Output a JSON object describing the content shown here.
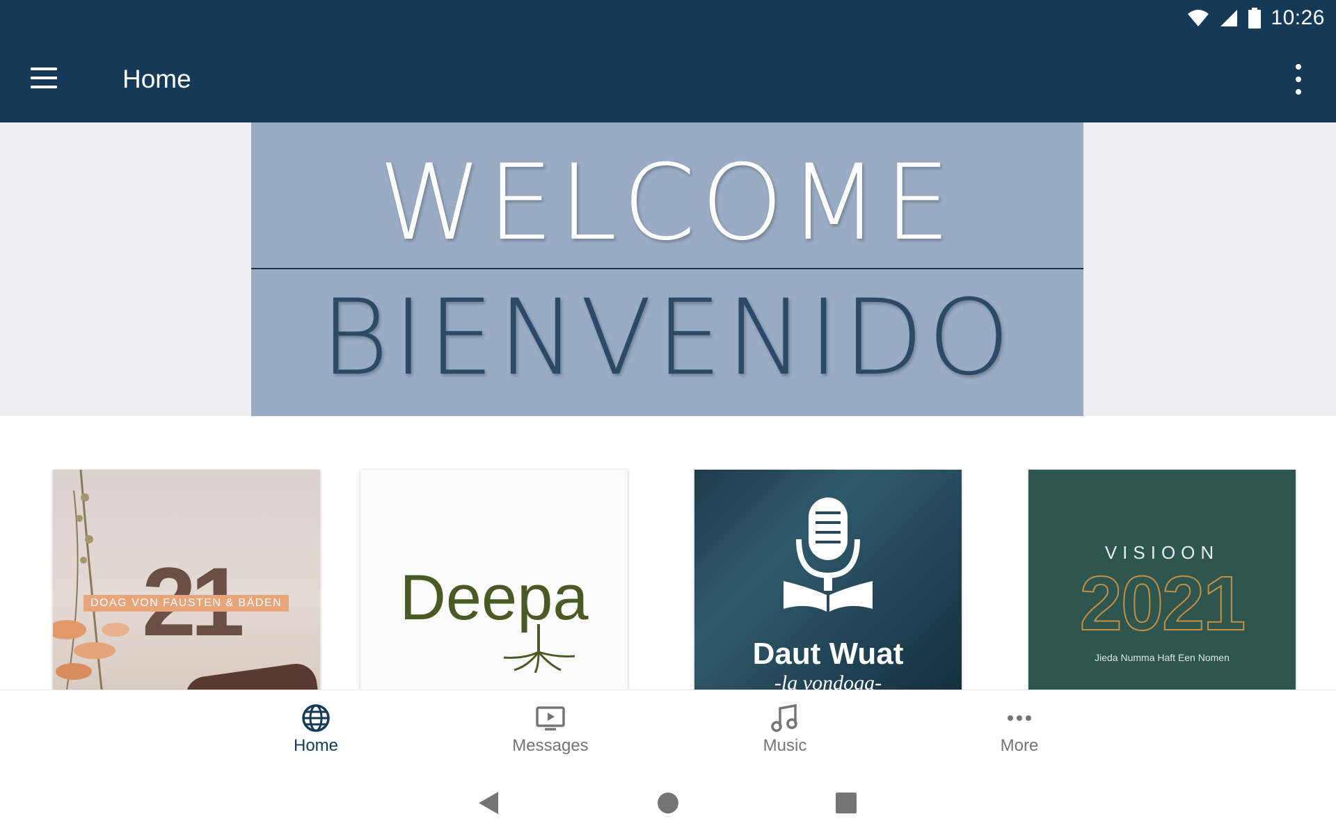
{
  "status_bar": {
    "time": "10:26"
  },
  "app_bar": {
    "title": "Home"
  },
  "hero": {
    "line1": "WELCOME",
    "line2": "BIENVENIDO"
  },
  "cards": [
    {
      "number": "21",
      "tag": "DOAG VON FAUSTEN & BÄDEN"
    },
    {
      "word": "Deepa"
    },
    {
      "title": "Daut Wuat",
      "subtitle": "-la vondoga-"
    },
    {
      "top": "VISIOON",
      "year": "2021",
      "subtitle": "Jieda Numma Haft Een Nomen"
    }
  ],
  "bottom_nav": {
    "items": [
      {
        "label": "Home",
        "icon": "globe-icon",
        "active": true
      },
      {
        "label": "Messages",
        "icon": "tv-play-icon",
        "active": false
      },
      {
        "label": "Music",
        "icon": "music-note-icon",
        "active": false
      },
      {
        "label": "More",
        "icon": "more-horizontal-icon",
        "active": false
      }
    ]
  },
  "colors": {
    "app_bar": "#153a57",
    "hero_bg": "#99acc4",
    "active_nav": "#153a57",
    "inactive_nav": "#757575"
  }
}
